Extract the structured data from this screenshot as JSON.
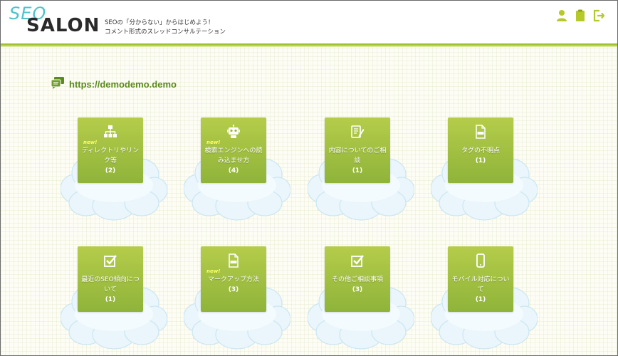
{
  "header": {
    "logo_top": "SEO",
    "logo_bottom": "SALON",
    "tagline_line1": "SEOの「分からない」からはじめよう！",
    "tagline_line2": "コメント形式のスレッドコンサルテーション",
    "icons": [
      "user-icon",
      "clipboard-icon",
      "logout-icon"
    ],
    "accent_color": "#a3c232"
  },
  "site": {
    "title": "https://demodemo.demo"
  },
  "categories": [
    {
      "name": "ディレクトリやリンク等",
      "count": "(2)",
      "new": "new!",
      "icon": "sitemap-icon"
    },
    {
      "name": "検索エンジンへの読み込ませ方",
      "count": "(4)",
      "new": "new!",
      "icon": "robot-icon"
    },
    {
      "name": "内容についてのご相談",
      "count": "(1)",
      "new": "",
      "icon": "edit-document-icon"
    },
    {
      "name": "タグの不明点",
      "count": "(1)",
      "new": "",
      "icon": "html-file-icon"
    },
    {
      "name": "最近のSEO傾向について",
      "count": "(1)",
      "new": "",
      "icon": "checkbox-icon"
    },
    {
      "name": "マークアップ方法",
      "count": "(3)",
      "new": "new!",
      "icon": "html-file-icon"
    },
    {
      "name": "その他ご相談事項",
      "count": "(3)",
      "new": "",
      "icon": "checkbox-icon"
    },
    {
      "name": "モバイル対応について",
      "count": "(1)",
      "new": "",
      "icon": "mobile-icon"
    }
  ]
}
